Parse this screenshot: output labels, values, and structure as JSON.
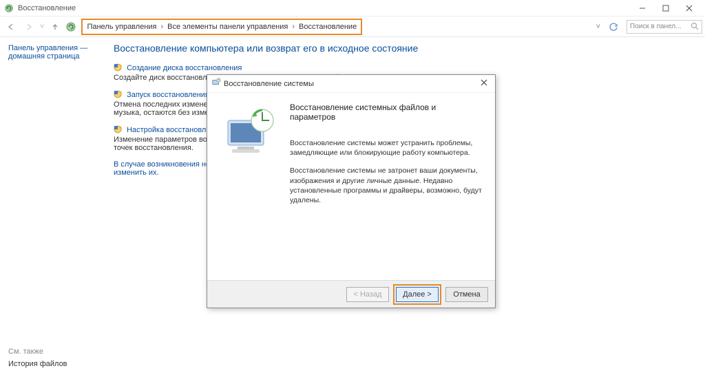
{
  "window": {
    "title": "Восстановление"
  },
  "breadcrumb": {
    "a": "Панель управления",
    "b": "Все элементы панели управления",
    "c": "Восстановление"
  },
  "search": {
    "placeholder": "Поиск в панел..."
  },
  "side": {
    "line1": "Панель управления —",
    "line2": "домашняя страница",
    "see_also": "См. также",
    "history": "История файлов"
  },
  "main": {
    "heading": "Восстановление компьютера или возврат его в исходное состояние",
    "items": [
      {
        "link": "Создание диска восстановления",
        "desc": "Создайте диск восстановления для устранения неисправностей, связанных с запуском компьютера."
      },
      {
        "link": "Запуск восстановления сист",
        "desc": "Отмена последних изменений в\nмузыка, остаются без изменени"
      },
      {
        "link": "Настройка восстановления с",
        "desc": "Изменение параметров восстан\nточек восстановления."
      }
    ],
    "extra": {
      "text1": "В случае возникновения неиспр",
      "text2": "изменить их."
    }
  },
  "dialog": {
    "title": "Восстановление системы",
    "heading": "Восстановление системных файлов и параметров",
    "p1": "Восстановление системы может устранить проблемы, замедляющие или блокирующие работу компьютера.",
    "p2": "Восстановление системы не затронет ваши документы, изображения и другие личные данные. Недавно установленные программы и драйверы, возможно, будут удалены.",
    "back": "< Назад",
    "next": "Далее >",
    "cancel": "Отмена"
  }
}
